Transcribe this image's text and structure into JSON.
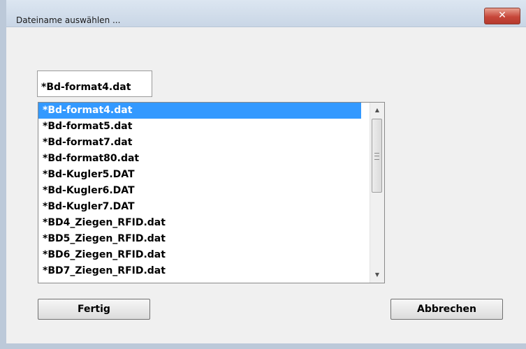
{
  "window": {
    "title": "Dateiname auswählen ...",
    "close_label": "✕"
  },
  "filename_input": {
    "value": "*Bd-format4.dat"
  },
  "file_list": {
    "selected_index": 0,
    "items": [
      "*Bd-format4.dat",
      "*Bd-format5.dat",
      "*Bd-format7.dat",
      "*Bd-format80.dat",
      "*Bd-Kugler5.DAT",
      "*Bd-Kugler6.DAT",
      "*Bd-Kugler7.DAT",
      "*BD4_Ziegen_RFID.dat",
      "*BD5_Ziegen_RFID.dat",
      "*BD6_Ziegen_RFID.dat",
      "*BD7_Ziegen_RFID.dat"
    ]
  },
  "scrollbar": {
    "up_icon": "▲",
    "down_icon": "▼"
  },
  "buttons": {
    "fertig_label": "Fertig",
    "abbrechen_label": "Abbrechen"
  }
}
